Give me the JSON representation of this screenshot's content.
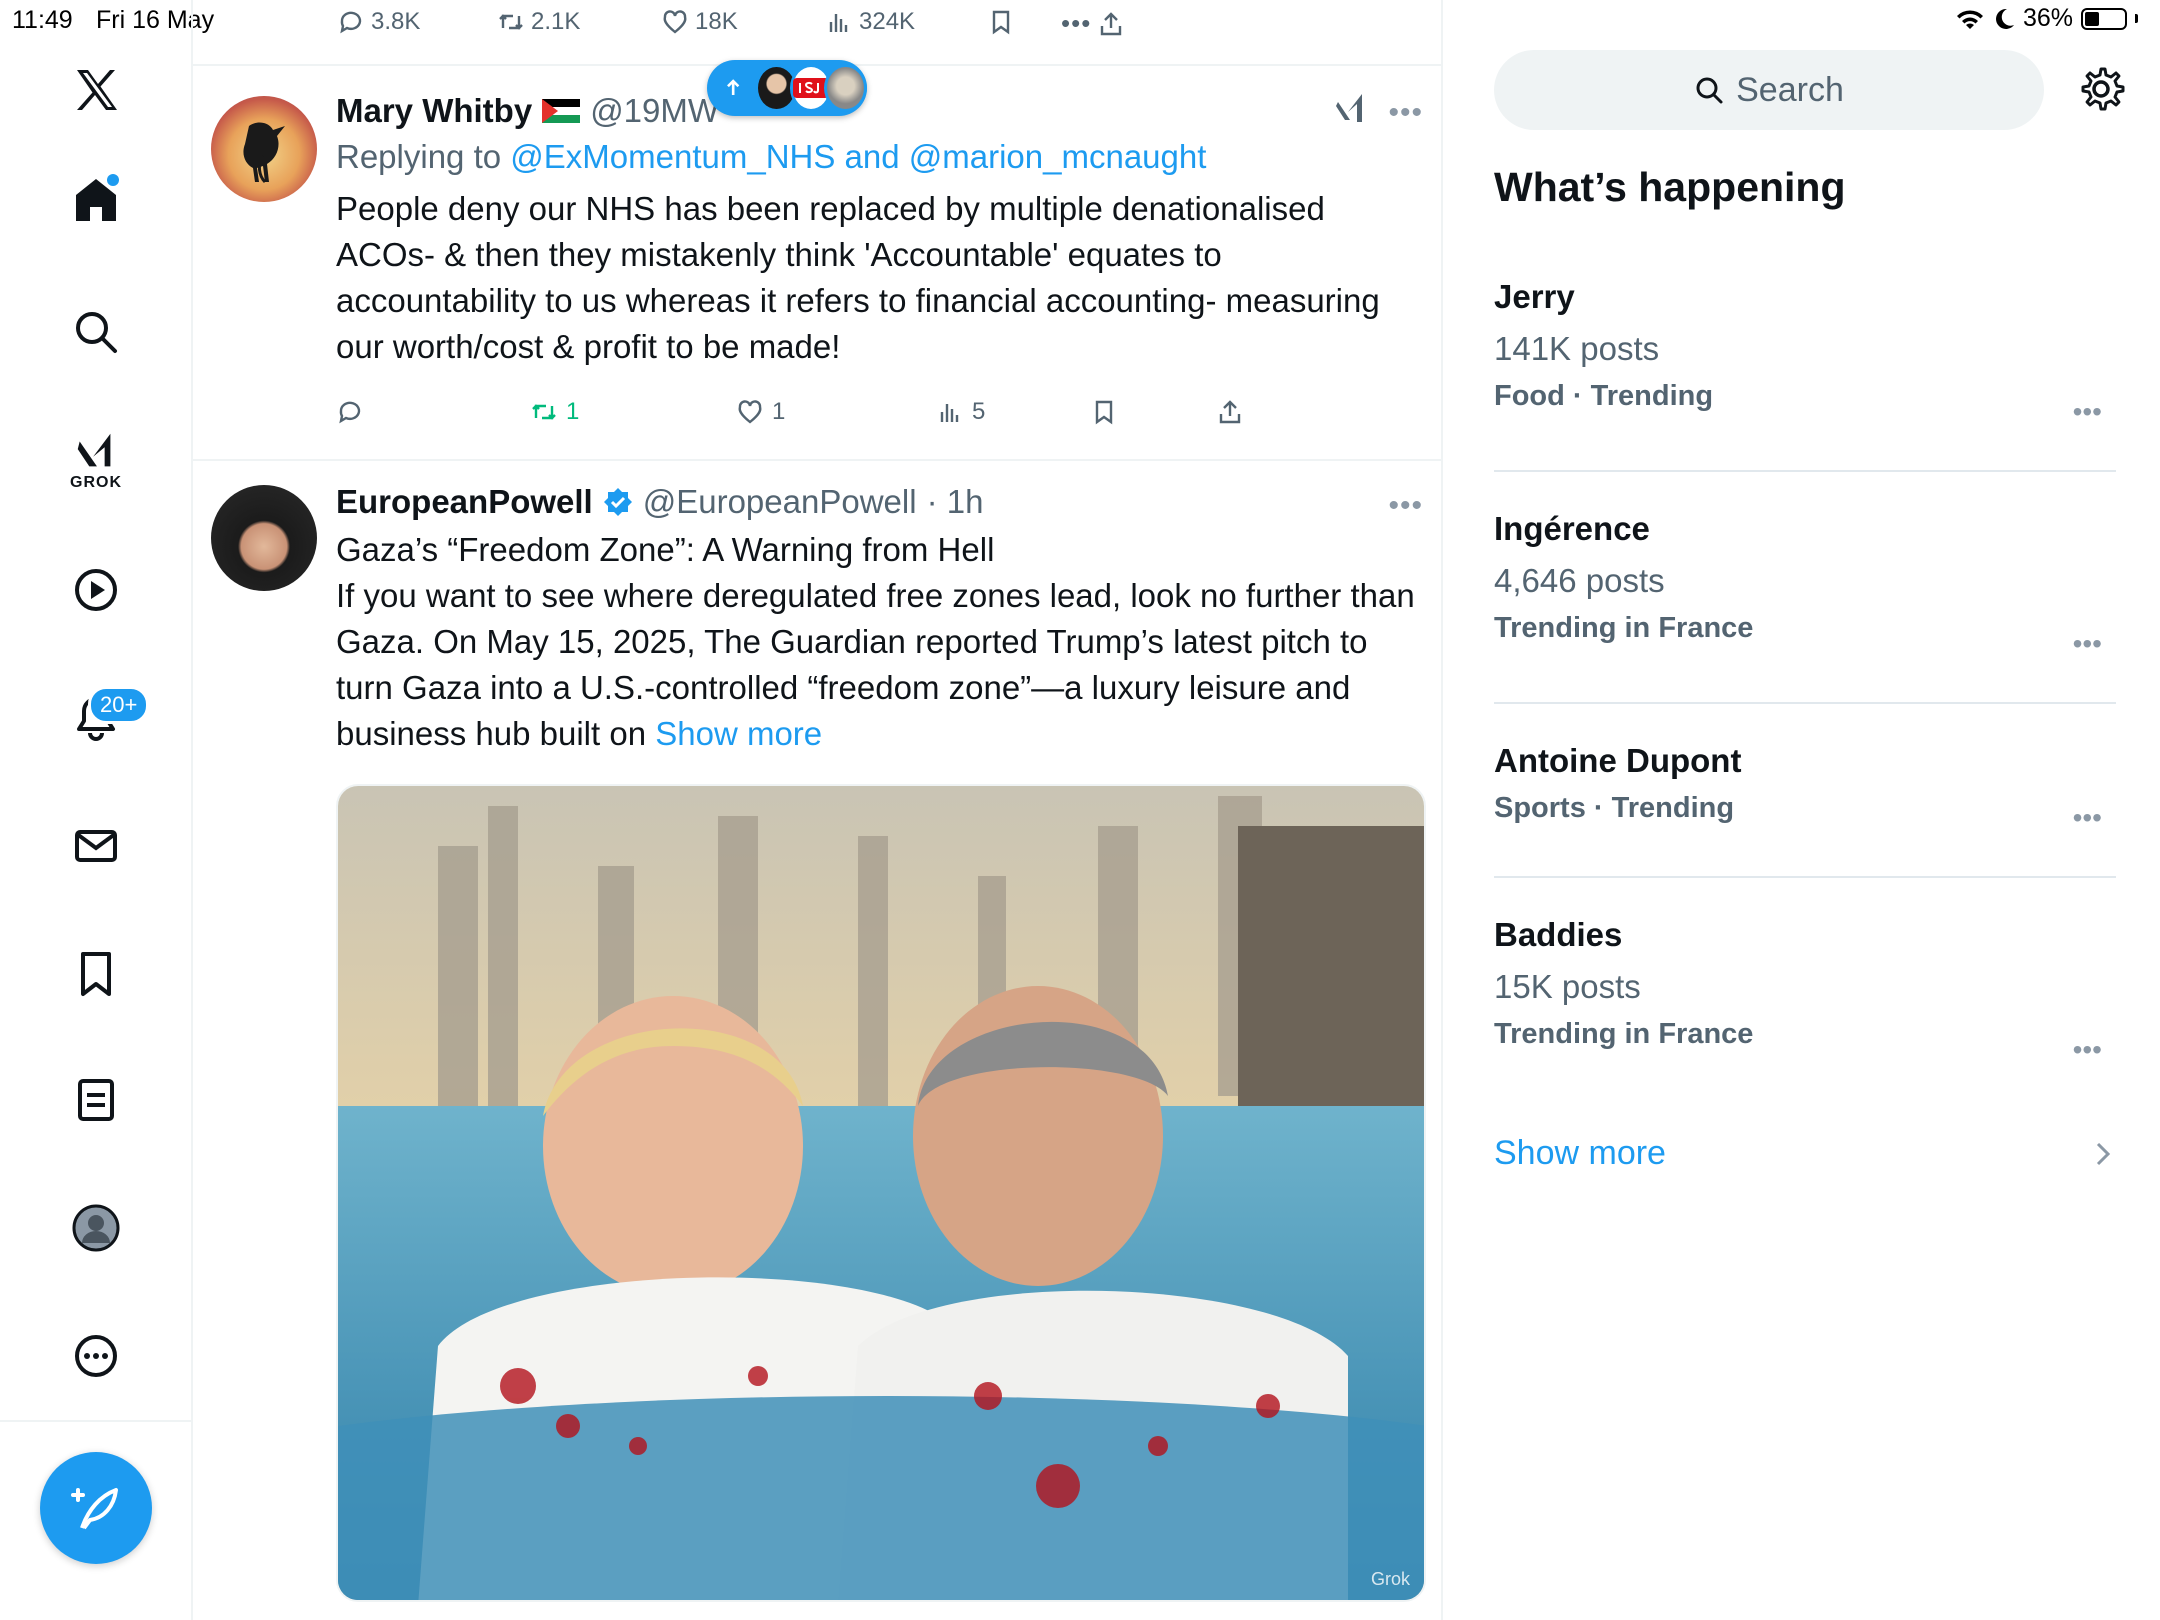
{
  "status": {
    "time": "11:49",
    "date": "Fri 16 May",
    "battery": "36%"
  },
  "nav": {
    "notifications_badge": "20+",
    "grok_label": "GROK"
  },
  "top_metrics": {
    "replies": "3.8K",
    "reposts": "2.1K",
    "likes": "18K",
    "views": "324K"
  },
  "tweets": [
    {
      "display_name": "Mary Whitby",
      "handle": "@19MW",
      "replying_prefix": "Replying to",
      "replying_to": "@ExMomentum_NHS and @marion_mcnaught",
      "text": "People deny our NHS has been replaced by multiple denationalised ACOs- & then they mistakenly think 'Accountable' equates to accountability to us whereas it refers to financial accounting- measuring our worth/cost & profit to be made!",
      "reposts": "1",
      "likes": "1",
      "views": "5"
    },
    {
      "display_name": "EuropeanPowell",
      "handle": "@EuropeanPowell",
      "time": "· 1h",
      "text": "Gaza’s “Freedom Zone”: A Warning from Hell\nIf you want to see where deregulated free zones lead, look no further than Gaza. On May 15, 2025, The Guardian reported Trump’s latest pitch to turn Gaza into a U.S.-controlled “freedom zone”—a luxury leisure and business hub built on ",
      "show_more": "Show more",
      "media_watermark": "Grok"
    }
  ],
  "sidebar": {
    "search_placeholder": "Search",
    "section_title": "What’s happening",
    "trends": [
      {
        "name": "Jerry",
        "posts": "141K posts",
        "context": "Food · Trending"
      },
      {
        "name": "Ingérence",
        "posts": "4,646 posts",
        "context": "Trending in France"
      },
      {
        "name": "Antoine Dupont",
        "posts": "",
        "context": "Sports · Trending"
      },
      {
        "name": "Baddies",
        "posts": "15K posts",
        "context": "Trending in France"
      }
    ],
    "show_more": "Show more"
  },
  "colors": {
    "accent": "#1d9bf0",
    "text_primary": "#0f1419",
    "text_secondary": "#536471",
    "retweet_green": "#00ba7c"
  }
}
